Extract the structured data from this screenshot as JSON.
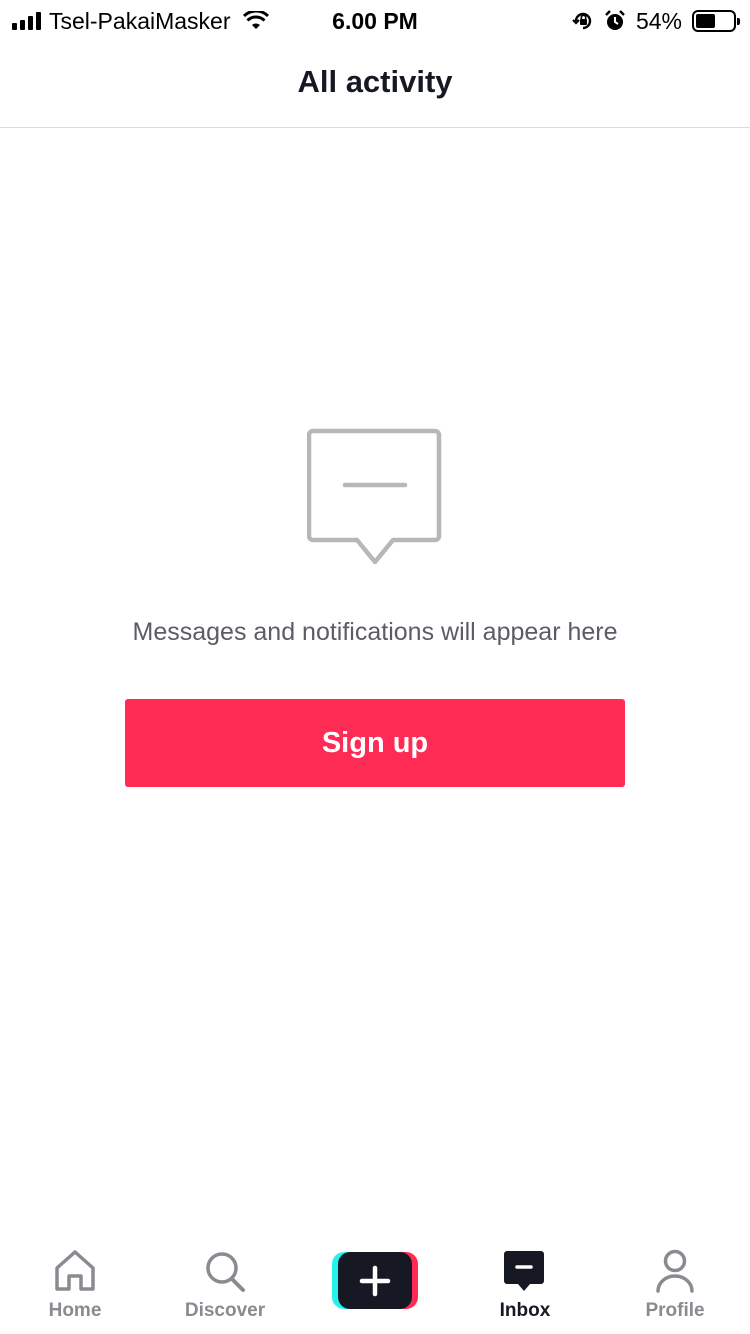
{
  "status_bar": {
    "carrier": "Tsel-PakaiMasker",
    "time": "6.00 PM",
    "battery_percent": "54%",
    "battery_level": 0.54,
    "icons": [
      "signal-icon",
      "wifi-icon",
      "orientation-lock-icon",
      "alarm-icon",
      "battery-icon"
    ]
  },
  "header": {
    "title": "All activity"
  },
  "empty_state": {
    "icon": "message-bubble-icon",
    "message": "Messages and notifications will appear here",
    "signup_label": "Sign up"
  },
  "tab_bar": {
    "tabs": [
      {
        "label": "Home",
        "icon": "home-icon",
        "active": false
      },
      {
        "label": "Discover",
        "icon": "search-icon",
        "active": false
      },
      {
        "label": "",
        "icon": "plus-icon",
        "active": false
      },
      {
        "label": "Inbox",
        "icon": "inbox-icon",
        "active": true
      },
      {
        "label": "Profile",
        "icon": "person-icon",
        "active": false
      }
    ]
  },
  "colors": {
    "accent": "#fe2c55",
    "text_primary": "#161823",
    "text_secondary": "#8a8b91",
    "create_cyan": "#25f4ee"
  }
}
